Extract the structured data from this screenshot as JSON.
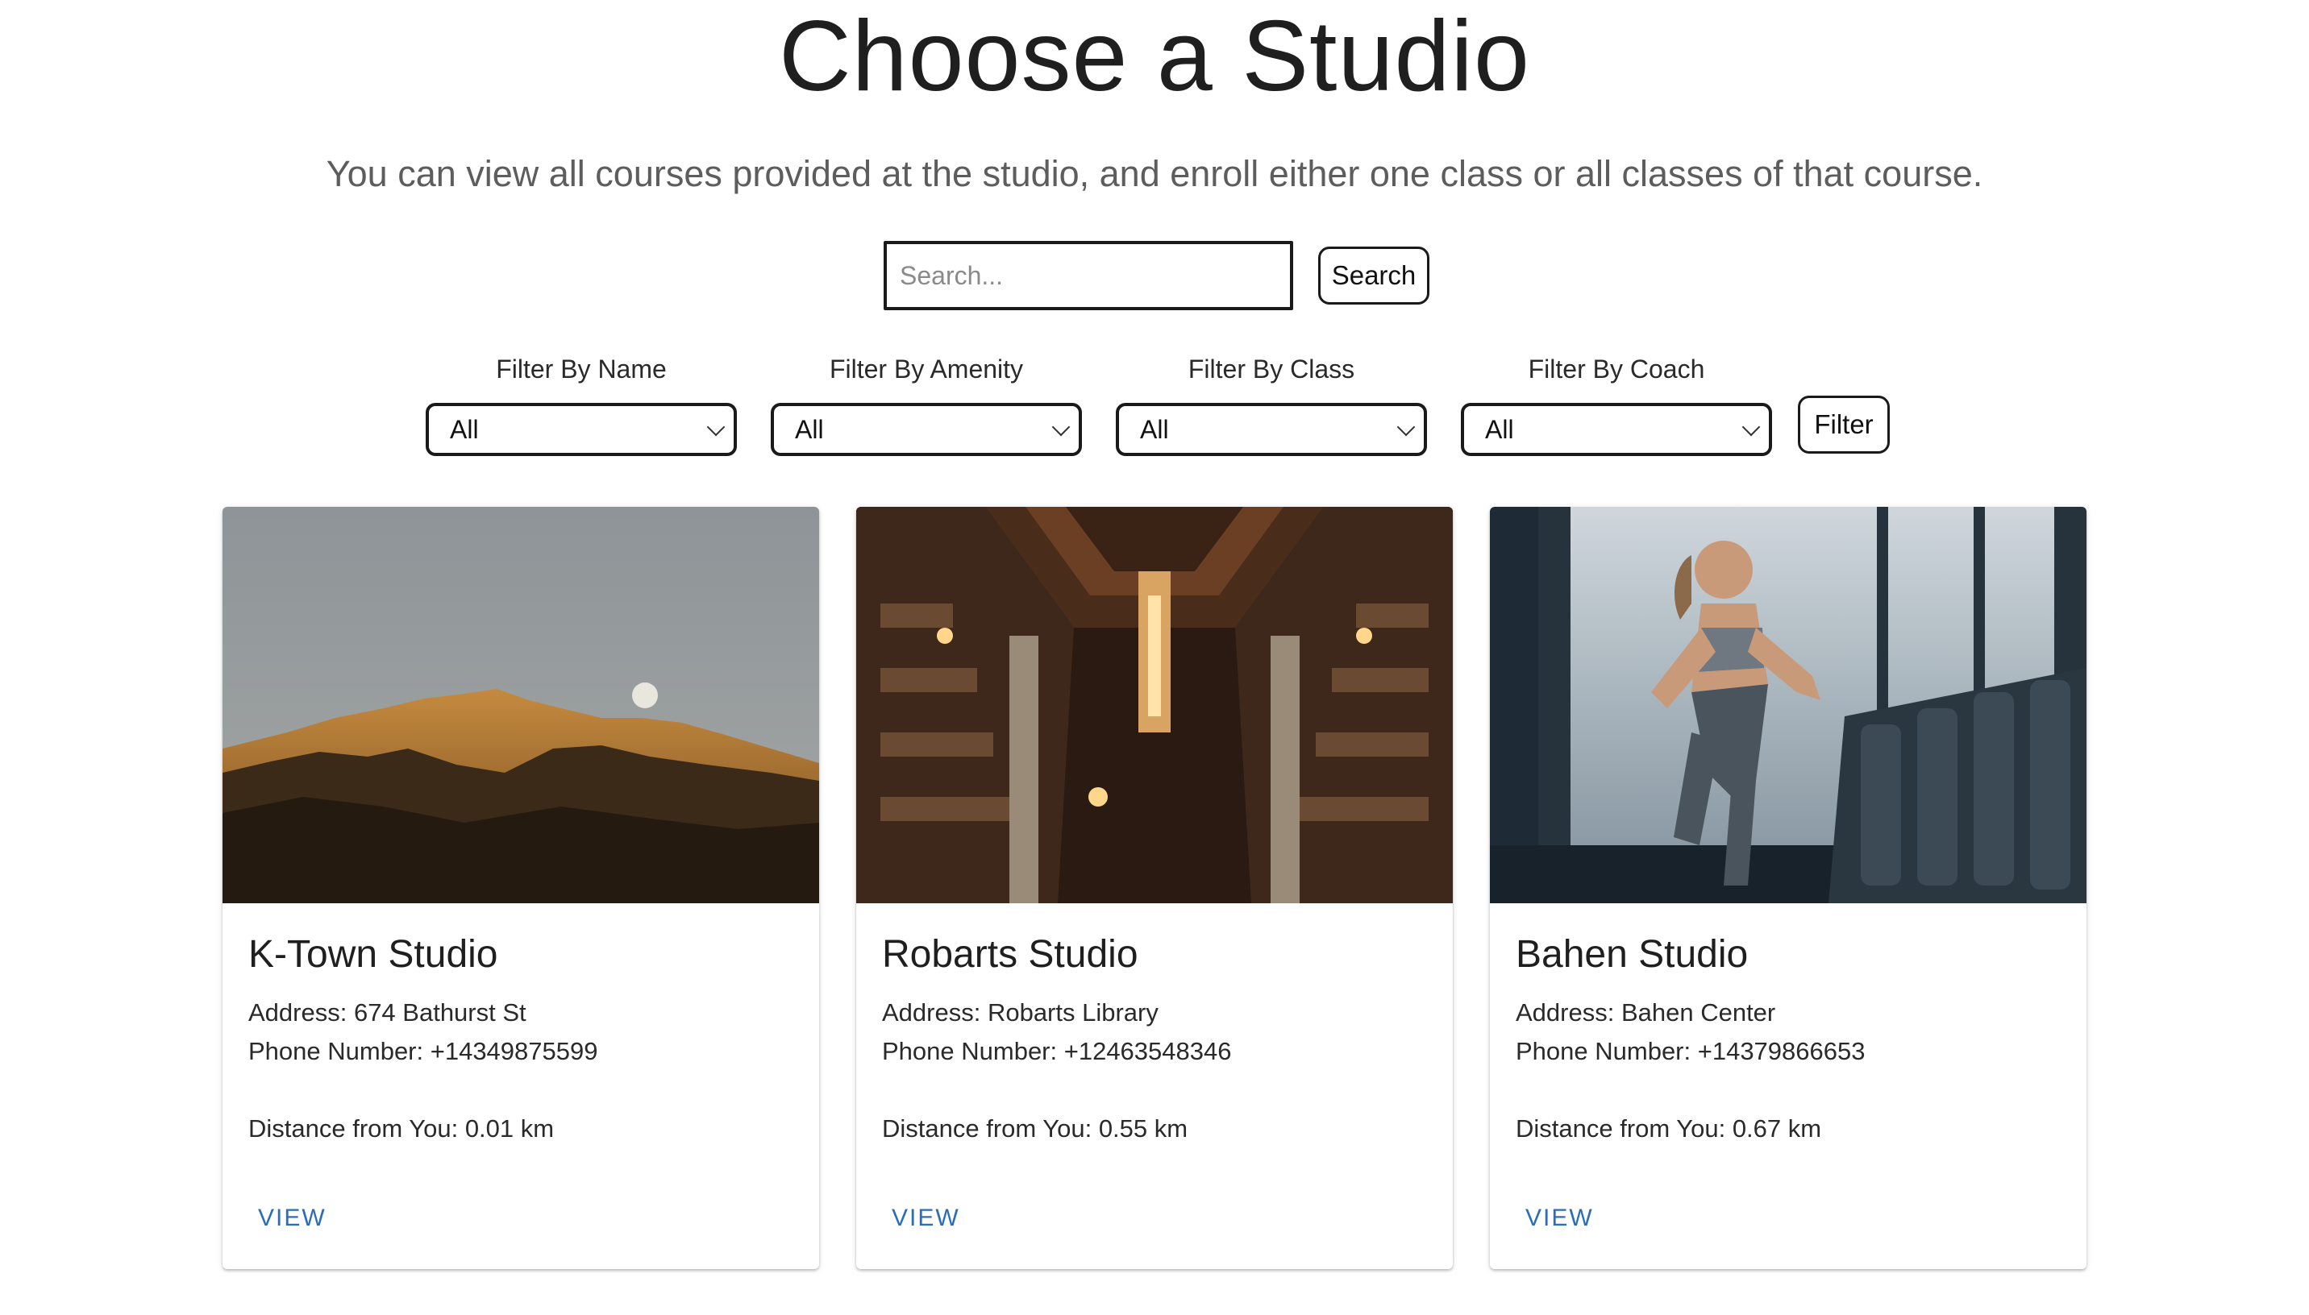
{
  "header": {
    "title": "Choose a Studio",
    "subtitle": "You can view all courses provided at the studio, and enroll either one class or all classes of that course."
  },
  "search": {
    "placeholder": "Search...",
    "value": "",
    "button_label": "Search"
  },
  "filters": [
    {
      "label": "Filter By Name",
      "selected": "All"
    },
    {
      "label": "Filter By Amenity",
      "selected": "All"
    },
    {
      "label": "Filter By Class",
      "selected": "All"
    },
    {
      "label": "Filter By Coach",
      "selected": "All"
    }
  ],
  "filter_button_label": "Filter",
  "studios": [
    {
      "name": "K-Town Studio",
      "address": "Address: 674 Bathurst St",
      "phone": "Phone Number: +14349875599",
      "distance": "Distance from You: 0.01 km",
      "action": "VIEW",
      "image": "mountain-landscape"
    },
    {
      "name": "Robarts Studio",
      "address": "Address: Robarts Library",
      "phone": "Phone Number: +12463548346",
      "distance": "Distance from You: 0.55 km",
      "action": "VIEW",
      "image": "library-interior"
    },
    {
      "name": "Bahen Studio",
      "address": "Address: Bahen Center",
      "phone": "Phone Number: +14379866653",
      "distance": "Distance from You: 0.67 km",
      "action": "VIEW",
      "image": "woman-on-treadmill"
    }
  ],
  "colors": {
    "link": "#2a6ebb",
    "border": "#1a1a1a",
    "subtitle": "#5d5d5d"
  }
}
